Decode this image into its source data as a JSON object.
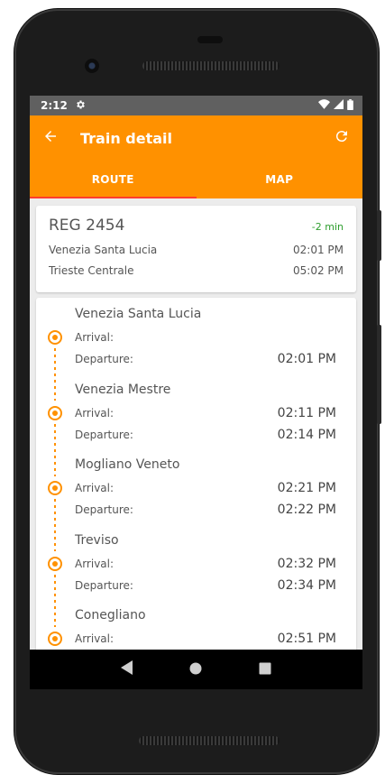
{
  "status": {
    "time": "2:12"
  },
  "appbar": {
    "title": "Train detail"
  },
  "tabs": [
    {
      "label": "ROUTE"
    },
    {
      "label": "MAP"
    }
  ],
  "summary": {
    "train": "REG 2454",
    "delay": "-2 min",
    "origin": {
      "station": "Venezia Santa Lucia",
      "time": "02:01 PM"
    },
    "destination": {
      "station": "Trieste Centrale",
      "time": "05:02 PM"
    }
  },
  "labels": {
    "arrival": "Arrival:",
    "departure": "Departure:"
  },
  "stops": [
    {
      "name": "Venezia Santa Lucia",
      "arrival": "",
      "departure": "02:01 PM"
    },
    {
      "name": "Venezia Mestre",
      "arrival": "02:11 PM",
      "departure": "02:14 PM"
    },
    {
      "name": "Mogliano Veneto",
      "arrival": "02:21 PM",
      "departure": "02:22 PM"
    },
    {
      "name": "Treviso",
      "arrival": "02:32 PM",
      "departure": "02:34 PM"
    },
    {
      "name": "Conegliano",
      "arrival": "02:51 PM",
      "departure": ""
    }
  ],
  "colors": {
    "accent": "#ff9100",
    "tab_indicator": "#ff3d2e",
    "delay": "#2e9e2e",
    "statusbar": "#606060"
  },
  "icons": {
    "back": "arrow-left-icon",
    "refresh": "refresh-icon",
    "settings": "gear-icon",
    "wifi": "wifi-icon",
    "signal": "signal-icon",
    "battery": "battery-icon",
    "stop_marker": "stop-marker-icon",
    "nav_back": "nav-back-icon",
    "nav_home": "nav-home-icon",
    "nav_recents": "nav-recents-icon"
  }
}
